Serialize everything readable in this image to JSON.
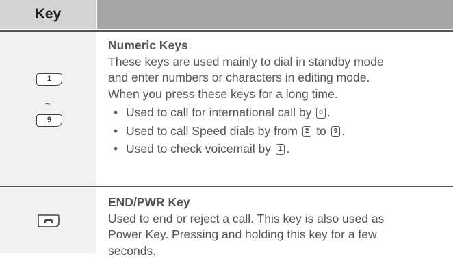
{
  "header": {
    "key_label": "Key"
  },
  "rows": [
    {
      "icon_top": "1",
      "icon_sep": "~",
      "icon_bottom": "9",
      "title": "Numeric Keys",
      "lines": [
        "These keys are used mainly to dial in standby mode",
        "and enter numbers or characters in editing mode.",
        "When you press these keys for a long time."
      ],
      "bullets": [
        {
          "before": "Used to call for international call by",
          "keys": [
            "0"
          ],
          "after": "."
        },
        {
          "before": "Used to call Speed dials by from",
          "keys": [
            "2",
            "9"
          ],
          "between": "to",
          "after": "."
        },
        {
          "before": "Used to check voicemail by",
          "keys": [
            "1"
          ],
          "after": "."
        }
      ]
    },
    {
      "icon": "end-key",
      "title": "END/PWR Key",
      "lines": [
        "Used to end or reject a call. This key is also used as",
        "Power Key. Pressing and holding this key for a few",
        "seconds."
      ]
    }
  ]
}
